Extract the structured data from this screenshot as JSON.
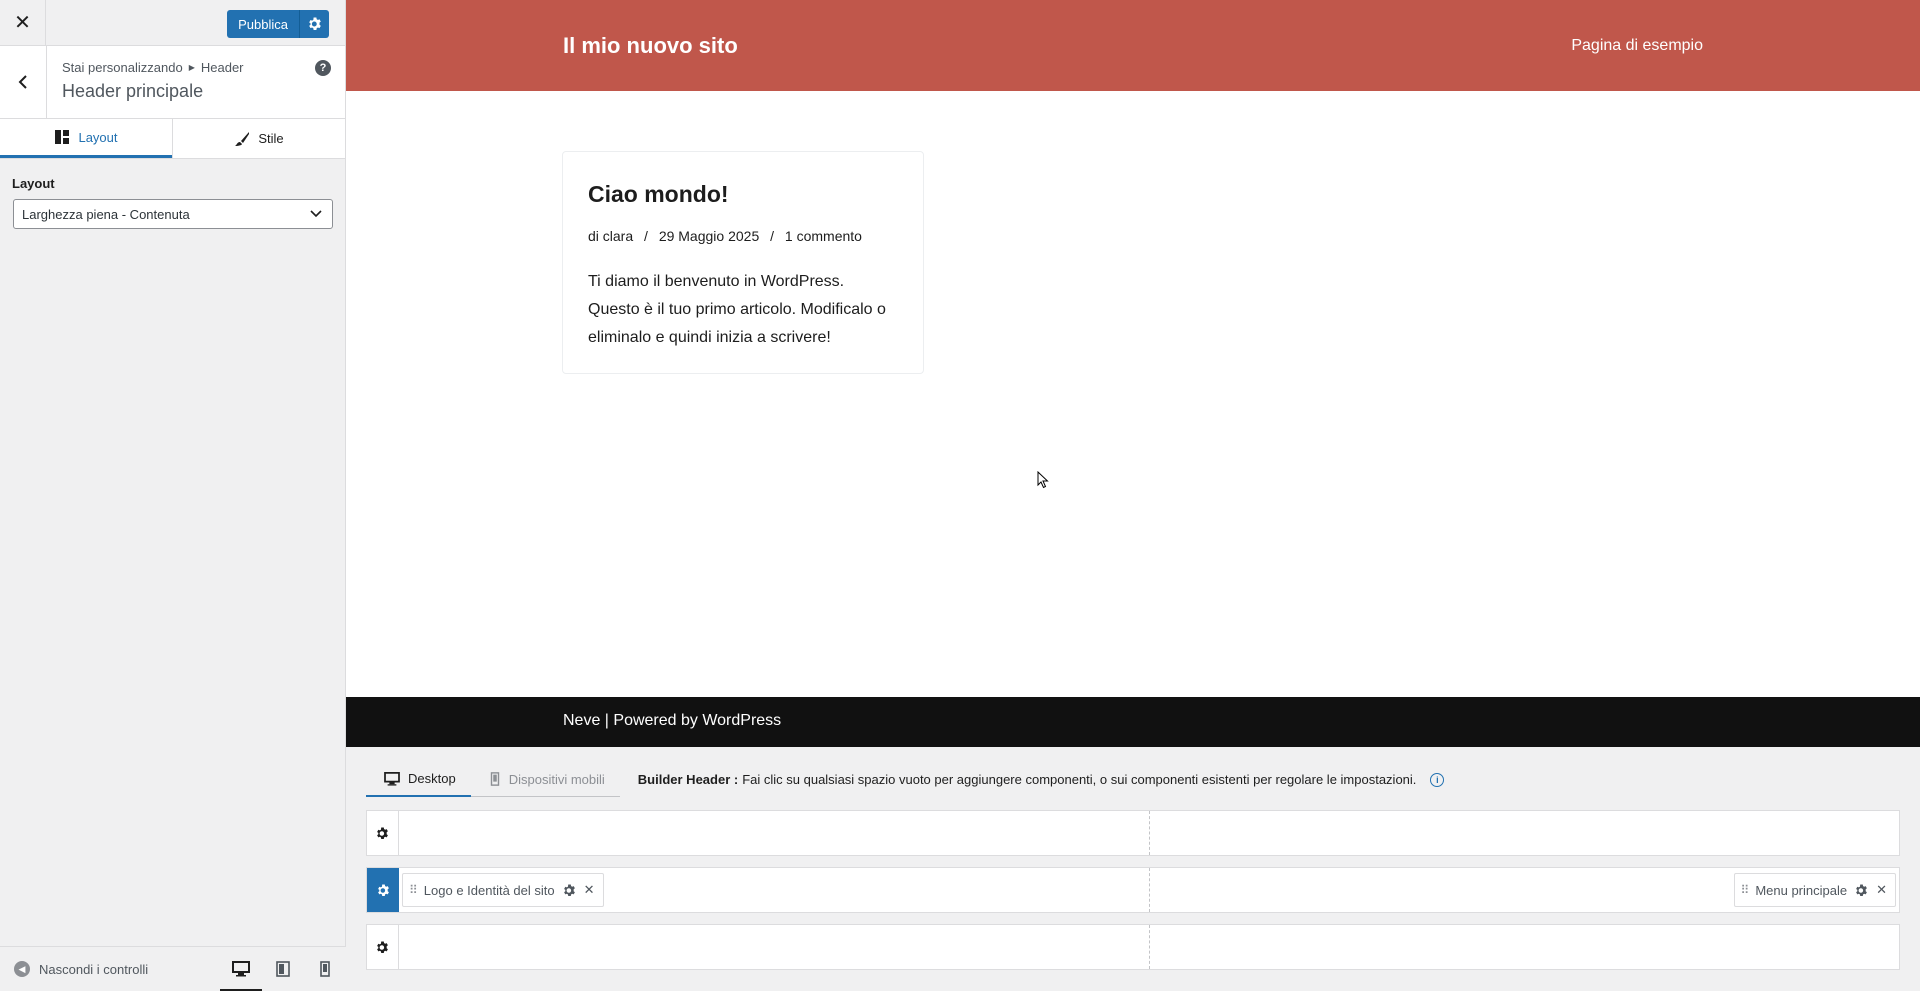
{
  "sidebar": {
    "close_label": "✕",
    "publish_label": "Pubblica",
    "breadcrumb": {
      "prefix": "Stai personalizzando",
      "parent": "Header"
    },
    "section_title": "Header principale",
    "help_label": "?",
    "tabs": [
      {
        "label": "Layout",
        "icon": "layout-icon",
        "active": true
      },
      {
        "label": "Stile",
        "icon": "brush-icon",
        "active": false
      }
    ],
    "control": {
      "label": "Layout",
      "value": "Larghezza piena - Contenuta"
    },
    "footer": {
      "hide_controls_label": "Nascondi i controlli",
      "devices": [
        "desktop-icon",
        "tablet-icon",
        "mobile-icon"
      ],
      "active_device": "desktop-icon"
    }
  },
  "preview": {
    "site_title": "Il mio nuovo sito",
    "nav_item": "Pagina di esempio",
    "post": {
      "title": "Ciao mondo!",
      "meta": {
        "author": "di clara",
        "date": "29 Maggio 2025",
        "comments": "1 commento",
        "separator": "/"
      },
      "excerpt": "Ti diamo il benvenuto in WordPress. Questo è il tuo primo articolo. Modificalo o eliminalo e quindi inizia a scrivere!"
    },
    "footer_text": "Neve | Powered by WordPress",
    "colors": {
      "header_bg": "#c0574b",
      "footer_bg": "#111111"
    }
  },
  "builder": {
    "tabs": [
      {
        "label": "Desktop",
        "icon": "desktop-icon",
        "active": true
      },
      {
        "label": "Dispositivi mobili",
        "icon": "mobile-icon",
        "active": false
      }
    ],
    "info_title": "Builder Header :",
    "info_text": "Fai clic su qualsiasi spazio vuoto per aggiungere componenti, o sui componenti esistenti per regolare le impostazioni.",
    "rows": [
      {
        "name": "top-row",
        "active": false,
        "components": []
      },
      {
        "name": "main-row",
        "active": true,
        "components": [
          {
            "label": "Logo e Identità del sito",
            "position": "left"
          },
          {
            "label": "Menu principale",
            "position": "right"
          }
        ]
      },
      {
        "name": "bottom-row",
        "active": false,
        "components": []
      }
    ],
    "accent_color": "#2271b1"
  }
}
